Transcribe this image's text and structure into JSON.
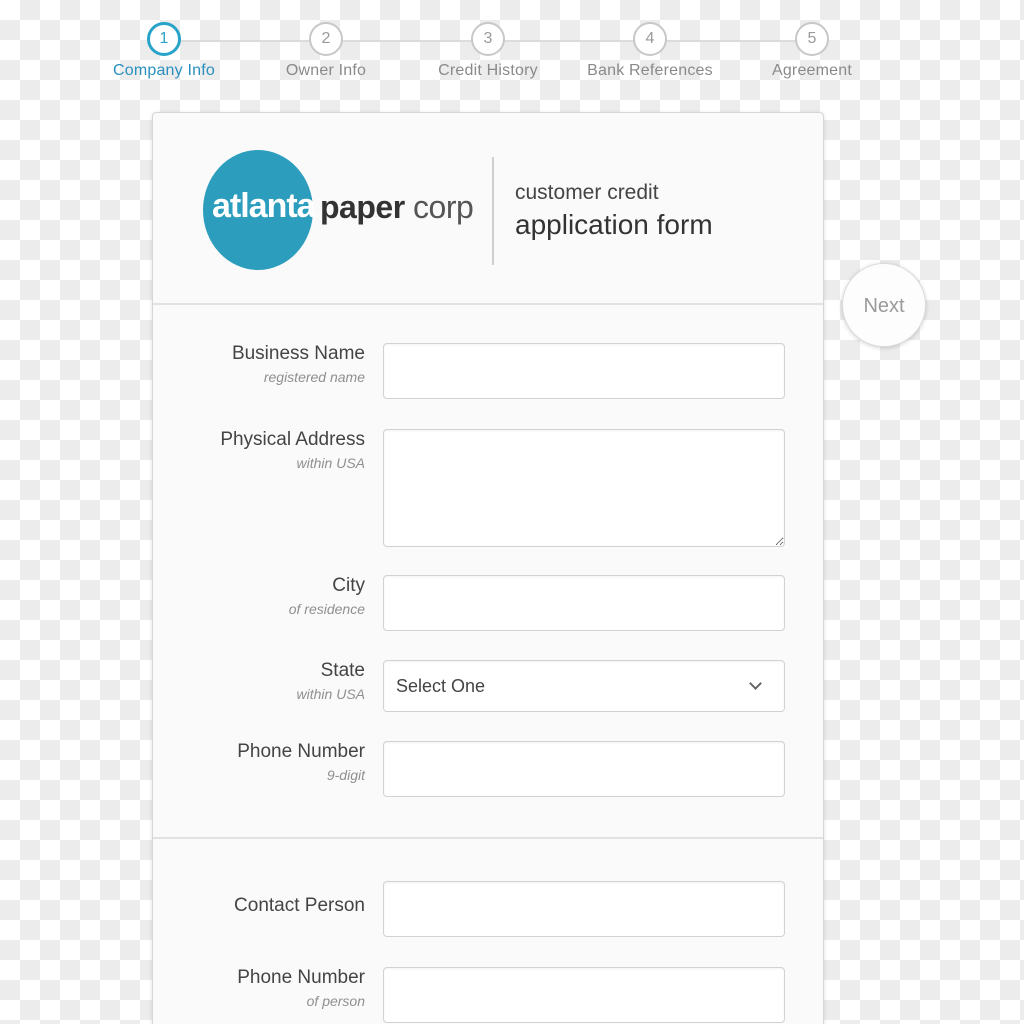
{
  "stepper": {
    "steps": [
      {
        "number": "1",
        "label": "Company Info"
      },
      {
        "number": "2",
        "label": "Owner Info"
      },
      {
        "number": "3",
        "label": "Credit History"
      },
      {
        "number": "4",
        "label": "Bank References"
      },
      {
        "number": "5",
        "label": "Agreement"
      }
    ],
    "active_step": 1
  },
  "header": {
    "logo_word_1": "atlanta",
    "logo_word_2_bold": "paper",
    "logo_word_2_light": "corp",
    "subtitle_line_1": "customer credit",
    "subtitle_line_2": "application form"
  },
  "form": {
    "business_name": {
      "label": "Business Name",
      "sublabel": "registered name",
      "value": ""
    },
    "physical_address": {
      "label": "Physical Address",
      "sublabel": "within USA",
      "value": ""
    },
    "city": {
      "label": "City",
      "sublabel": "of residence",
      "value": ""
    },
    "state": {
      "label": "State",
      "sublabel": "within USA",
      "selected": "Select One"
    },
    "phone_number": {
      "label": "Phone Number",
      "sublabel": "9-digit",
      "value": ""
    },
    "contact_person": {
      "label": "Contact Person",
      "value": ""
    },
    "contact_phone": {
      "label": "Phone Number",
      "sublabel": "of person",
      "value": ""
    }
  },
  "next_button": {
    "label": "Next"
  },
  "colors": {
    "accent": "#2aa3c8",
    "logo_circle": "#2d9dbe",
    "step_inactive": "#c8c8c8"
  }
}
